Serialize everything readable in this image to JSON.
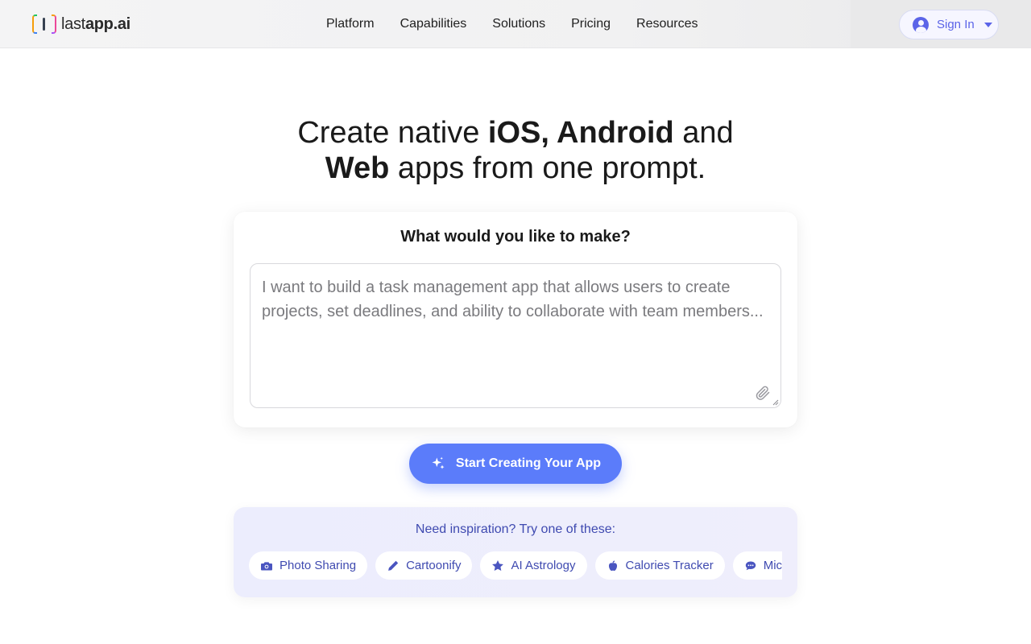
{
  "header": {
    "logo": {
      "light": "last",
      "bold": "app.ai"
    },
    "nav": [
      "Platform",
      "Capabilities",
      "Solutions",
      "Pricing",
      "Resources"
    ],
    "signin_label": "Sign In"
  },
  "hero": {
    "line1_a": "Create native ",
    "line1_b": "iOS, Android",
    "line1_c": " and",
    "line2_a": "Web",
    "line2_b": " apps from one prompt."
  },
  "prompt": {
    "title": "What would you like to make?",
    "placeholder": "I want to build a task management app that allows users to create projects, set deadlines, and ability to collaborate with team members...",
    "value": ""
  },
  "cta": {
    "label": "Start Creating Your App"
  },
  "inspiration": {
    "title": "Need inspiration? Try one of these:",
    "chips": [
      {
        "label": "Photo Sharing",
        "icon": "camera-icon"
      },
      {
        "label": "Cartoonify",
        "icon": "pencil-icon"
      },
      {
        "label": "AI Astrology",
        "icon": "star-icon"
      },
      {
        "label": "Calories Tracker",
        "icon": "apple-icon"
      },
      {
        "label": "Micro",
        "icon": "chat-icon"
      }
    ]
  },
  "colors": {
    "accent": "#5b7cfa",
    "brand_indigo": "#5b64e8",
    "chip_text": "#3f4ab0"
  }
}
